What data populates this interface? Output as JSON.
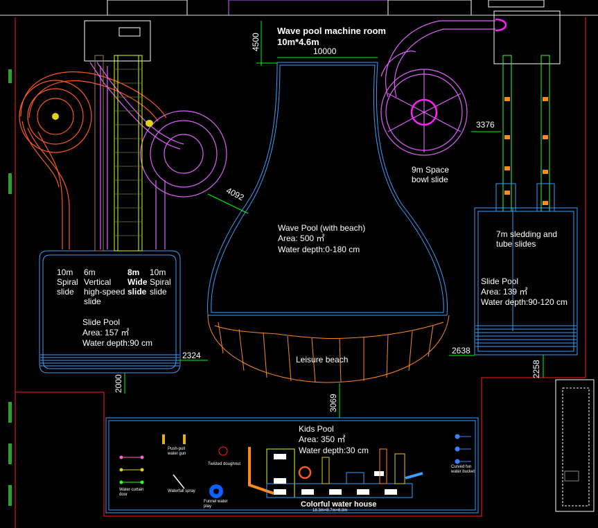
{
  "dimensions": {
    "machine_room_height": "4500",
    "machine_room_width": "10000",
    "wave_pool_to_slides": "4092",
    "bowl_slide_offset": "3376",
    "slide_pool_gap": "2324",
    "beach_right_gap": "2638",
    "slide_pool_to_wall": "2000",
    "beach_to_kids": "3069",
    "right_pool_to_wall": "2258"
  },
  "machine_room": {
    "line1": "Wave pool machine room",
    "line2": "10m*4.6m"
  },
  "wave_pool": {
    "title": "Wave Pool (with beach)",
    "area": "Area: 500 ㎡",
    "depth": "Water depth:0-180 cm"
  },
  "leisure_beach": "Leisure beach",
  "slides_left": [
    {
      "height": "10m",
      "name": "Spiral\nslide"
    },
    {
      "height": "6m",
      "name": "Vertical\nhigh-speed\nslide"
    },
    {
      "height": "8m",
      "name": "Wide\nslide"
    },
    {
      "height": "10m",
      "name": "Spiral\nslide"
    }
  ],
  "slide_pool_left": {
    "title": "Slide Pool",
    "area": "Area: 157 ㎡",
    "depth": "Water depth:90 cm"
  },
  "space_bowl": "9m Space\nbowl slide",
  "sledding": "7m sledding and\ntube slides",
  "slide_pool_right": {
    "title": "Slide Pool",
    "area": "Area: 139 ㎡",
    "depth": "Water depth:90-120 cm"
  },
  "kids_pool": {
    "title": "Kids Pool",
    "area": "Area: 350 ㎡",
    "depth": "Water depth:30 cm"
  },
  "kids_items": {
    "push_pull": "Push-pull\nwater gun",
    "twisted": "Twisted doughnut",
    "curtain": "Water curtain\ndoor",
    "waterfall": "Waterfall spray",
    "funnel": "Funnel water\nplay",
    "curved": "Curved fun\nwater bucket",
    "house": "Colorful water house",
    "house_dims": "18.3m×8.7m×6.8m"
  },
  "colors": {
    "background": "#000000",
    "pool_outline": "#3aa0ff",
    "dimension": "#00ff00",
    "boundary": "#ff2020",
    "orange_slide": "#ff5a1e",
    "violet_slide": "#e060ff",
    "magenta_bowl": "#ff22ff",
    "beach": "#ff8a20"
  }
}
